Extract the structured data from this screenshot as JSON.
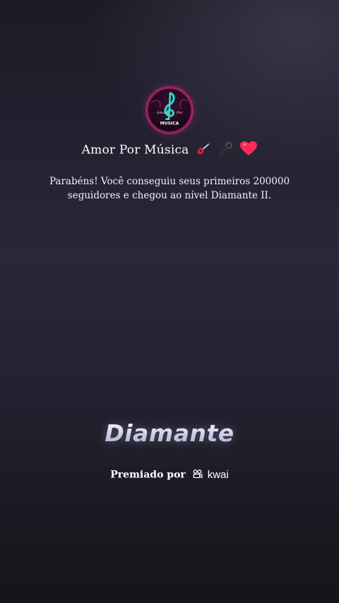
{
  "profile": {
    "name": "Amor Por Música",
    "name_emojis": [
      "guitar-icon",
      "microphone-icon",
      "heart-icon"
    ],
    "avatar_text": "MUSICA"
  },
  "message": {
    "line1": "Parabéns! Você conseguiu seus primeiros 200000",
    "line2": "seguidores e chegou ao nível Diamante II."
  },
  "level": {
    "title": "Diamante"
  },
  "award": {
    "label": "Premiado por",
    "brand": "kwai"
  },
  "colors": {
    "accent_pink": "#e2288c",
    "accent_teal": "#34d6c8",
    "heart": "#ff2a5a",
    "level_text": "#d9dbec"
  }
}
